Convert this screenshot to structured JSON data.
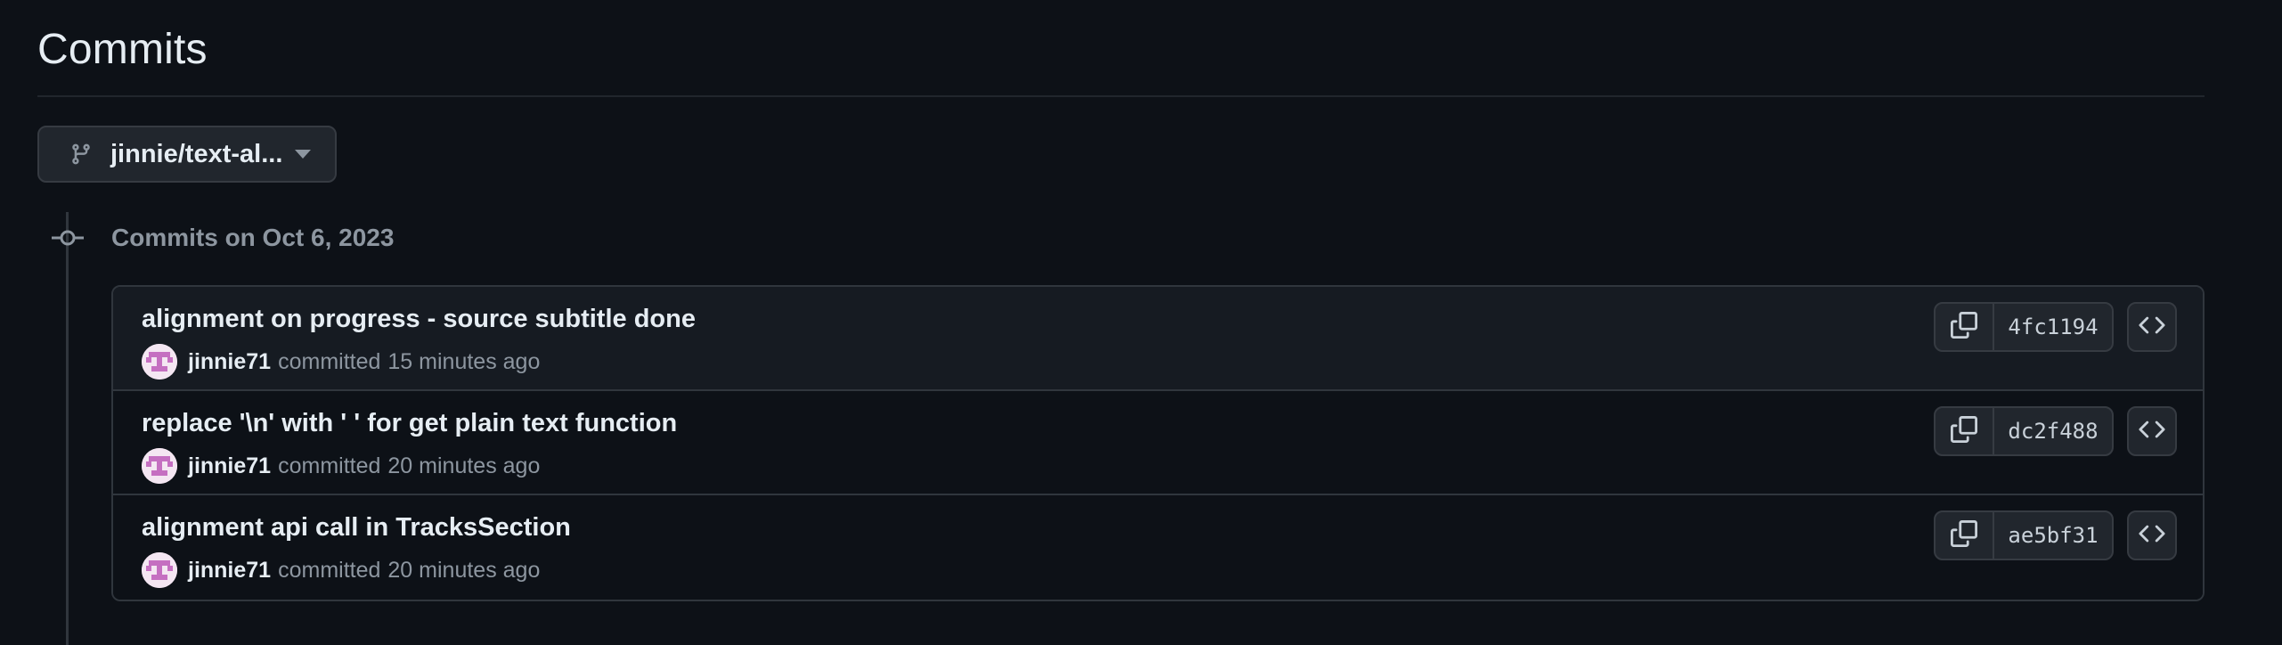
{
  "page": {
    "title": "Commits"
  },
  "branch_selector": {
    "label": "jinnie/text-al...",
    "icon": "git-branch-icon"
  },
  "commit_group": {
    "heading": "Commits on Oct 6, 2023",
    "commits": [
      {
        "message": "alignment on progress - source subtitle done",
        "author": "jinnie71",
        "verb": "committed",
        "time": "15 minutes ago",
        "sha": "4fc1194"
      },
      {
        "message": "replace '\\n' with ' ' for get plain text function",
        "author": "jinnie71",
        "verb": "committed",
        "time": "20 minutes ago",
        "sha": "dc2f488"
      },
      {
        "message": "alignment api call in TracksSection",
        "author": "jinnie71",
        "verb": "committed",
        "time": "20 minutes ago",
        "sha": "ae5bf31"
      }
    ]
  },
  "colors": {
    "background": "#0d1117",
    "row_highlight": "#161b22",
    "border": "#30363d",
    "button_bg": "#21262d",
    "text_primary": "#e6edf3",
    "text_muted": "#8d96a0",
    "avatar_accent": "#c56fc1"
  }
}
